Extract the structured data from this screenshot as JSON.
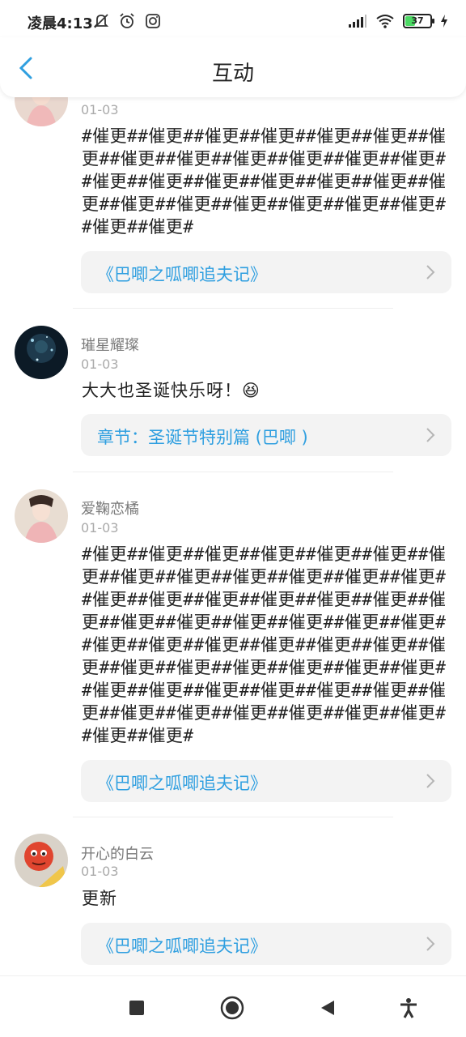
{
  "status_bar": {
    "time": "凌晨4:13",
    "battery": "37",
    "icons_left": [
      "mute-bell-icon",
      "alarm-icon",
      "instagram-icon"
    ],
    "icons_right": [
      "signal-icon",
      "wifi-icon",
      "battery-icon",
      "charging-icon"
    ]
  },
  "header": {
    "title": "互动",
    "back_icon": "back-chevron-icon"
  },
  "comments": [
    {
      "username": "",
      "date": "01-03",
      "text": "#催更##催更##催更##催更##催更##催更##催更##催更##催更##催更##催更##催更##催更##催更##催更##催更##催更##催更##催更##催更##催更##催更##催更##催更##催更##催更##催更##催更#",
      "link": "《巴唧之呱唧追夫记》"
    },
    {
      "username": "璀星耀璨",
      "date": "01-03",
      "text": "大大也圣诞快乐呀！😆",
      "link": "章节：圣诞节特别篇 (巴唧 )"
    },
    {
      "username": "爱鞠恋橘",
      "date": "01-03",
      "text": "#催更##催更##催更##催更##催更##催更##催更##催更##催更##催更##催更##催更##催更##催更##催更##催更##催更##催更##催更##催更##催更##催更##催更##催更##催更##催更##催更##催更##催更##催更##催更##催更##催更##催更##催更##催更##催更##催更##催更##催更##催更##催更##催更##催更##催更##催更##催更##催更##催更##催更##催更##催更##催更##催更#",
      "link": "《巴唧之呱唧追夫记》"
    },
    {
      "username": "开心的白云",
      "date": "01-03",
      "text": "更新",
      "link": "《巴唧之呱唧追夫记》"
    }
  ],
  "nav_bar": {
    "buttons": [
      "recent-apps-icon",
      "home-icon",
      "back-icon",
      "accessibility-icon"
    ]
  },
  "colors": {
    "link": "#2f9fe0",
    "card_bg": "#f3f3f3",
    "username": "#7a7a7a",
    "date": "#aaaaaa"
  }
}
